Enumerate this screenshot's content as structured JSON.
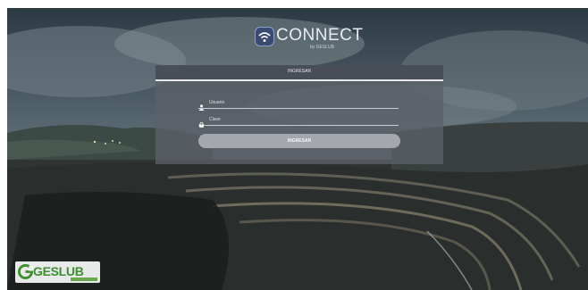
{
  "brand": {
    "name": "CONNECT",
    "sub": "by GESLUB"
  },
  "login": {
    "title": "INGRESAR",
    "username_placeholder": "Usuario",
    "password_placeholder": "Clave",
    "submit_label": "INGRESAR"
  },
  "footer": {
    "logo_text": "GESLUB"
  },
  "icons": {
    "brand": "wifi-icon",
    "user": "user-icon",
    "password": "lock-icon",
    "footer_mark": "g-logo-icon"
  },
  "colors": {
    "panel": "#5c6068",
    "button": "#a4a8ae",
    "brand_badge": "#3a4b73",
    "logo_green": "#3d8f2f"
  }
}
